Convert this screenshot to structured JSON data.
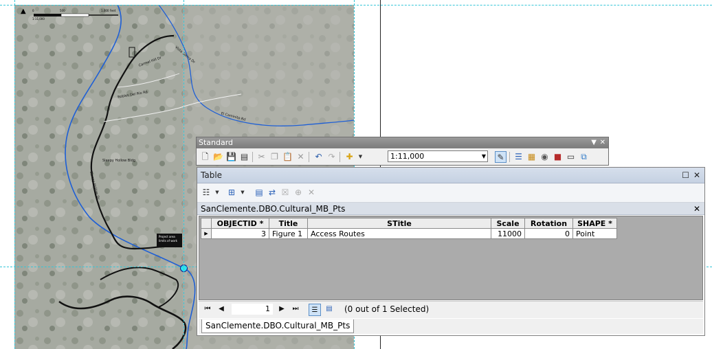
{
  "map": {
    "scale_ticks": [
      "0",
      "500",
      "1,000 Feet"
    ],
    "scale_ratio": "1:11,000",
    "road_labels": [
      "Carmel Hill Dr",
      "Vista Sierra Dr",
      "Robles Del Rio Rd",
      "El Caminito Rd",
      "Sleepy Hollow Dr"
    ],
    "callout_text": "Project area limits of work",
    "small_label": "Sleepy Hollow Bldg"
  },
  "standard_toolbar": {
    "title": "Standard",
    "scale_value": "1:11,000"
  },
  "table_window": {
    "title": "Table",
    "layer_name": "SanClemente.DBO.Cultural_MB_Pts",
    "columns": [
      "OBJECTID *",
      "Title",
      "STitle",
      "Scale",
      "Rotation",
      "SHAPE *"
    ],
    "rows": [
      [
        "3",
        "Figure 1",
        "Access Routes",
        "11000",
        "0",
        "Point"
      ]
    ],
    "current_record": "1",
    "selection_status": "(0 out of 1 Selected)",
    "tab_label": "SanClemente.DBO.Cultural_MB_Pts"
  },
  "colors": {
    "river": "#1e5fd6",
    "road": "#111111",
    "selected_point": "#2ce6f0",
    "guide": "#35c6d8"
  }
}
